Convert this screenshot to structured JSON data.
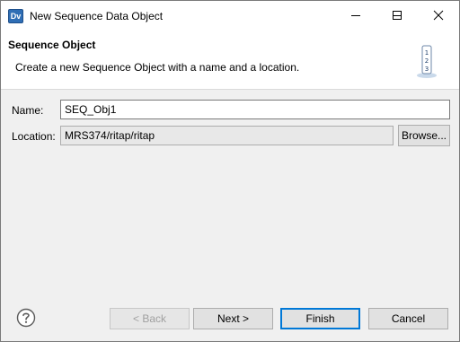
{
  "window": {
    "app_icon_text": "Dv",
    "title": "New Sequence Data Object",
    "controls": [
      "minimize-icon",
      "maximize-icon",
      "close-icon"
    ]
  },
  "header": {
    "title": "Sequence Object",
    "description": "Create a new Sequence Object with a name and a location.",
    "icon": "sequence-icon",
    "icon_digits": [
      "1",
      "2",
      "3"
    ]
  },
  "form": {
    "name_label": "Name:",
    "name_value": "SEQ_Obj1",
    "location_label": "Location:",
    "location_value": "MRS374/ritap/ritap",
    "browse_label": "Browse..."
  },
  "footer": {
    "help_icon": "help-icon",
    "back_label": "< Back",
    "next_label": "Next >",
    "finish_label": "Finish",
    "cancel_label": "Cancel"
  },
  "colors": {
    "focus_border": "#0078d7",
    "dialog_bg": "#f0f0f0"
  }
}
